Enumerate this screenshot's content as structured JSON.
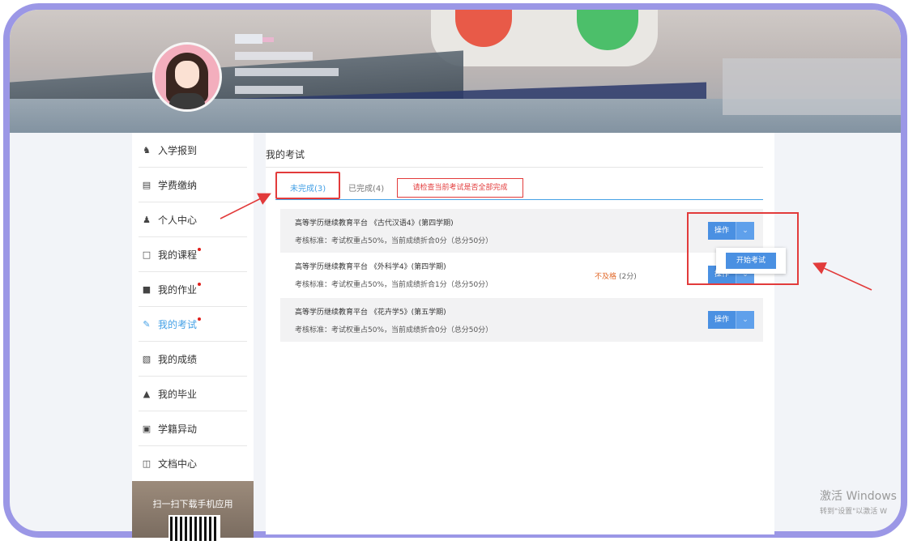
{
  "sidebar": {
    "items": [
      {
        "label": "入学报到",
        "icon": "user-tie-icon",
        "dot": false,
        "active": false
      },
      {
        "label": "学费缴纳",
        "icon": "credit-card-icon",
        "dot": false,
        "active": false
      },
      {
        "label": "个人中心",
        "icon": "person-icon",
        "dot": false,
        "active": false
      },
      {
        "label": "我的课程",
        "icon": "monitor-icon",
        "dot": true,
        "active": false
      },
      {
        "label": "我的作业",
        "icon": "book-icon",
        "dot": true,
        "active": false
      },
      {
        "label": "我的考试",
        "icon": "edit-icon",
        "dot": true,
        "active": true
      },
      {
        "label": "我的成绩",
        "icon": "clipboard-icon",
        "dot": false,
        "active": false
      },
      {
        "label": "我的毕业",
        "icon": "graduate-icon",
        "dot": false,
        "active": false
      },
      {
        "label": "学籍异动",
        "icon": "id-card-icon",
        "dot": false,
        "active": false
      },
      {
        "label": "文档中心",
        "icon": "document-icon",
        "dot": false,
        "active": false
      }
    ],
    "qr_title": "扫一扫下载手机应用"
  },
  "main": {
    "title": "我的考试",
    "tabs": [
      {
        "label": "未完成(3)",
        "active": true
      },
      {
        "label": "已完成(4)",
        "active": false
      }
    ],
    "warning": "请检查当前考试是否全部完成",
    "exams": [
      {
        "title": "高等学历继续教育平台 《古代汉语4》(第四学期)",
        "rule": "考核标准：考试权重占50%，当前成绩折合0分（总分50分）",
        "status": "",
        "score": ""
      },
      {
        "title": "高等学历继续教育平台 《外科学4》(第四学期)",
        "rule": "考核标准：考试权重占50%，当前成绩折合1分（总分50分）",
        "status": "不及格",
        "score": "(2分)"
      },
      {
        "title": "高等学历继续教育平台 《花卉学5》(第五学期)",
        "rule": "考核标准：考试权重占50%，当前成绩折合0分（总分50分）",
        "status": "",
        "score": ""
      }
    ],
    "op_label": "操作",
    "dropdown_caret": "⌄",
    "popup_label": "开始考试"
  },
  "windows": {
    "line1": "激活 Windows",
    "line2": "转到\"设置\"以激活 W"
  },
  "colors": {
    "accent": "#45a1e6",
    "button": "#4a90e2",
    "highlight": "#e23b3b",
    "frame": "#9b97e6"
  }
}
